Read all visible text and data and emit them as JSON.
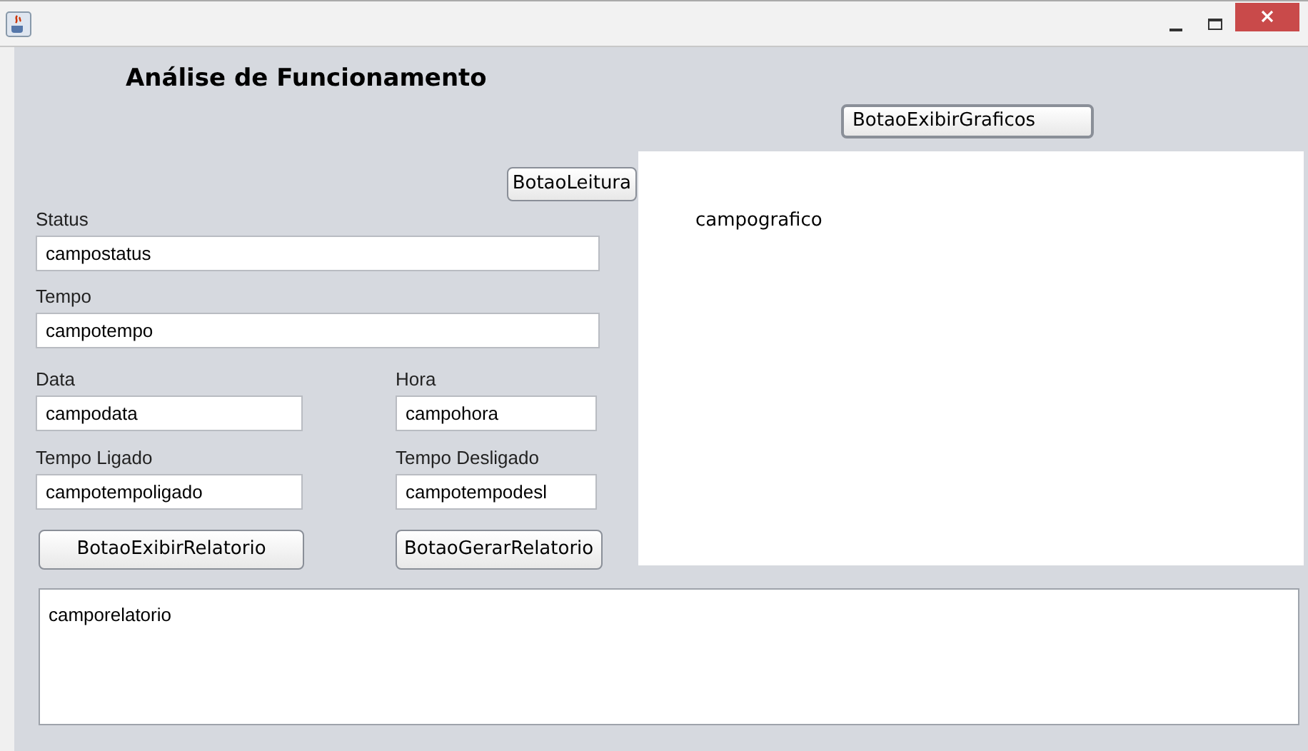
{
  "window": {
    "heading": "Análise de Funcionamento"
  },
  "buttons": {
    "exibir_graficos": "BotaoExibirGraficos",
    "leitura": "BotaoLeitura",
    "exibir_relatorio": "BotaoExibirRelatorio",
    "gerar_relatorio": "BotaoGerarRelatorio"
  },
  "fields": [
    {
      "label": "Status",
      "value": "campostatus"
    },
    {
      "label": "Tempo",
      "value": "campotempo"
    },
    {
      "label": "Data",
      "value": "campodata"
    },
    {
      "label": "Hora",
      "value": "campohora"
    },
    {
      "label": "Tempo Ligado",
      "value": "campotempoligado"
    },
    {
      "label": "Tempo Desligado",
      "value": "campotempodesl"
    }
  ],
  "chart_panel": {
    "text": "campografico"
  },
  "report_area": {
    "value": "camporelatorio"
  }
}
